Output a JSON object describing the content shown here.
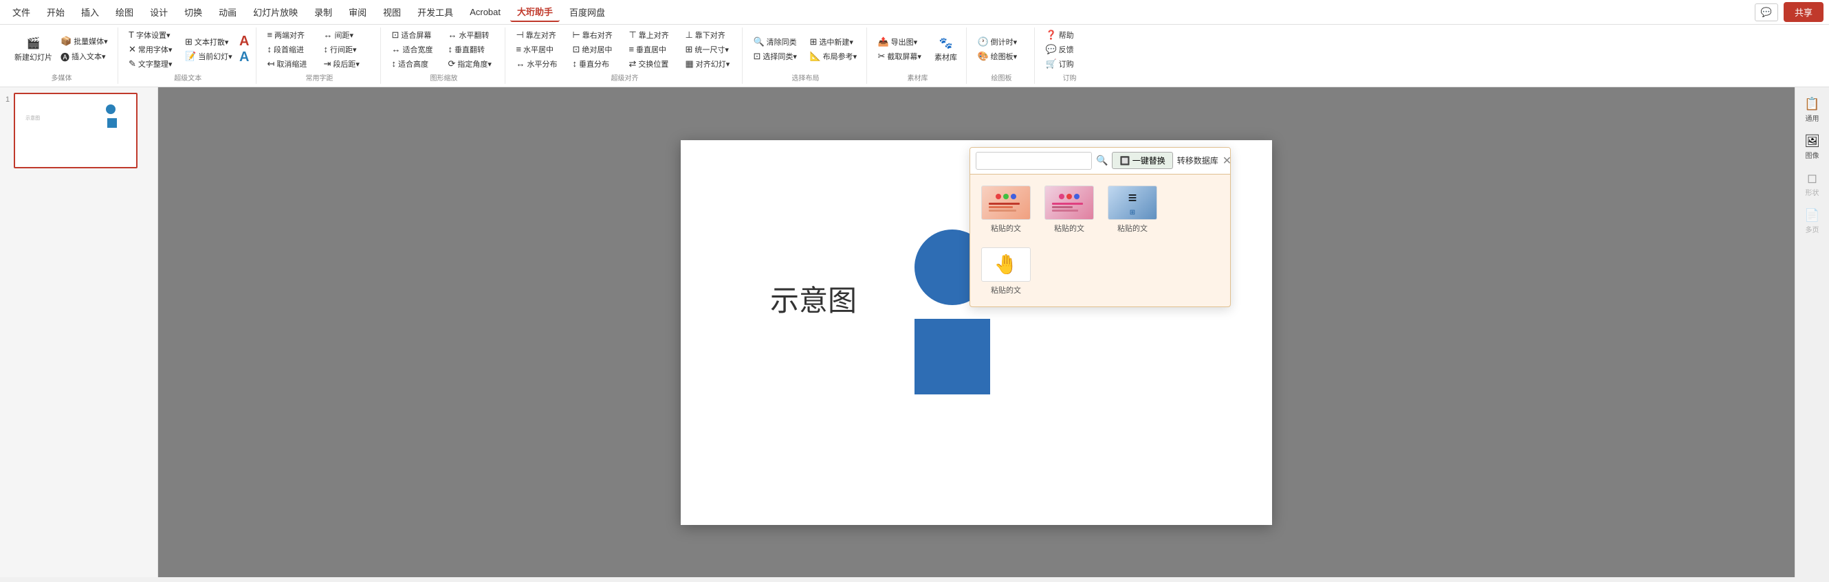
{
  "menubar": {
    "items": [
      "文件",
      "开始",
      "插入",
      "绘图",
      "设计",
      "切换",
      "动画",
      "幻灯片放映",
      "录制",
      "审阅",
      "视图",
      "开发工具",
      "Acrobat",
      "大珩助手",
      "百度网盘"
    ],
    "active_item": "大珩助手",
    "share_label": "共享",
    "chat_icon": "💬"
  },
  "toolbar": {
    "groups": [
      {
        "label": "多媒体",
        "items": [
          {
            "icon": "🎬",
            "label": "新建幻灯片"
          },
          {
            "icon": "📦",
            "label": "批量媒体"
          },
          {
            "icon": "A",
            "label": "插入文本"
          }
        ]
      },
      {
        "label": "超级文本",
        "items": [
          {
            "icon": "T",
            "label": "字体设置"
          },
          {
            "icon": "×",
            "label": "常用字体"
          },
          {
            "icon": "✎",
            "label": "文字整理"
          },
          {
            "icon": "⊞",
            "label": "文本打散"
          },
          {
            "icon": "📝",
            "label": "当前幻灯"
          }
        ]
      },
      {
        "label": "常用字距",
        "items": [
          {
            "icon": "≡",
            "label": "两端对齐"
          },
          {
            "icon": "↕",
            "label": "段首缩进"
          },
          {
            "icon": "↤",
            "label": "取消缩进"
          },
          {
            "icon": "↔",
            "label": "间距▾"
          },
          {
            "icon": "↕",
            "label": "行间距▾"
          },
          {
            "icon": "⇥",
            "label": "段后距▾"
          }
        ]
      },
      {
        "label": "图形缩放",
        "items": [
          {
            "icon": "⊡",
            "label": "适合屏幕"
          },
          {
            "icon": "↔",
            "label": "适合宽度"
          },
          {
            "icon": "↕",
            "label": "适合高度"
          },
          {
            "icon": "↔",
            "label": "水平翻转"
          },
          {
            "icon": "↕",
            "label": "垂直翻转"
          },
          {
            "icon": "⟳",
            "label": "指定角度"
          }
        ]
      },
      {
        "label": "超级对齐",
        "items": [
          {
            "icon": "⊣",
            "label": "靠左对齐"
          },
          {
            "icon": "⊢",
            "label": "靠右对齐"
          },
          {
            "icon": "⊤",
            "label": "靠上对齐"
          },
          {
            "icon": "⊥",
            "label": "靠下对齐"
          },
          {
            "icon": "≡",
            "label": "水平居中"
          },
          {
            "icon": "≡",
            "label": "绝对居中"
          },
          {
            "icon": "≡",
            "label": "垂直居中"
          },
          {
            "icon": "↔",
            "label": "水平分布"
          },
          {
            "icon": "↕",
            "label": "垂直分布"
          },
          {
            "icon": "⊞",
            "label": "统一尺寸"
          },
          {
            "icon": "⇄",
            "label": "交换位置"
          },
          {
            "icon": "▦",
            "label": "对齐幻灯"
          }
        ]
      },
      {
        "label": "选择布局",
        "items": [
          {
            "icon": "🔍",
            "label": "清除同类"
          },
          {
            "icon": "⊡",
            "label": "选择同类"
          },
          {
            "icon": "⊞",
            "label": "选中新建"
          },
          {
            "icon": "📐",
            "label": "布局参考"
          }
        ]
      },
      {
        "label": "素材库",
        "items": [
          {
            "icon": "📤",
            "label": "导出图"
          },
          {
            "icon": "✂",
            "label": "截取屏幕"
          },
          {
            "icon": "🎨",
            "label": "素材库"
          }
        ]
      },
      {
        "label": "绘图板",
        "items": [
          {
            "icon": "🕐",
            "label": "倒计时"
          },
          {
            "icon": "🎨",
            "label": "绘图板"
          }
        ]
      },
      {
        "label": "订购",
        "items": [
          {
            "icon": "❓",
            "label": "帮助"
          },
          {
            "icon": "💬",
            "label": "反馈"
          },
          {
            "icon": "🛒",
            "label": "订购"
          }
        ]
      }
    ]
  },
  "slide": {
    "number": "1",
    "canvas_text": "示意图"
  },
  "sidebar": {
    "items": [
      {
        "icon": "📋",
        "label": "通用"
      },
      {
        "icon": "🖼",
        "label": "图像"
      },
      {
        "icon": "◻",
        "label": "形状"
      },
      {
        "icon": "📄",
        "label": "多页"
      }
    ]
  },
  "floating_panel": {
    "search_placeholder": "",
    "replace_label": "🔲 一键替换",
    "transfer_label": "转移数据库",
    "close_label": "✕",
    "paste_items": [
      {
        "label": "粘贴的文",
        "type": "red"
      },
      {
        "label": "粘贴的文",
        "type": "pink"
      },
      {
        "label": "粘贴的文",
        "type": "blue"
      },
      {
        "label": "粘贴的文",
        "type": "hand"
      }
    ]
  }
}
